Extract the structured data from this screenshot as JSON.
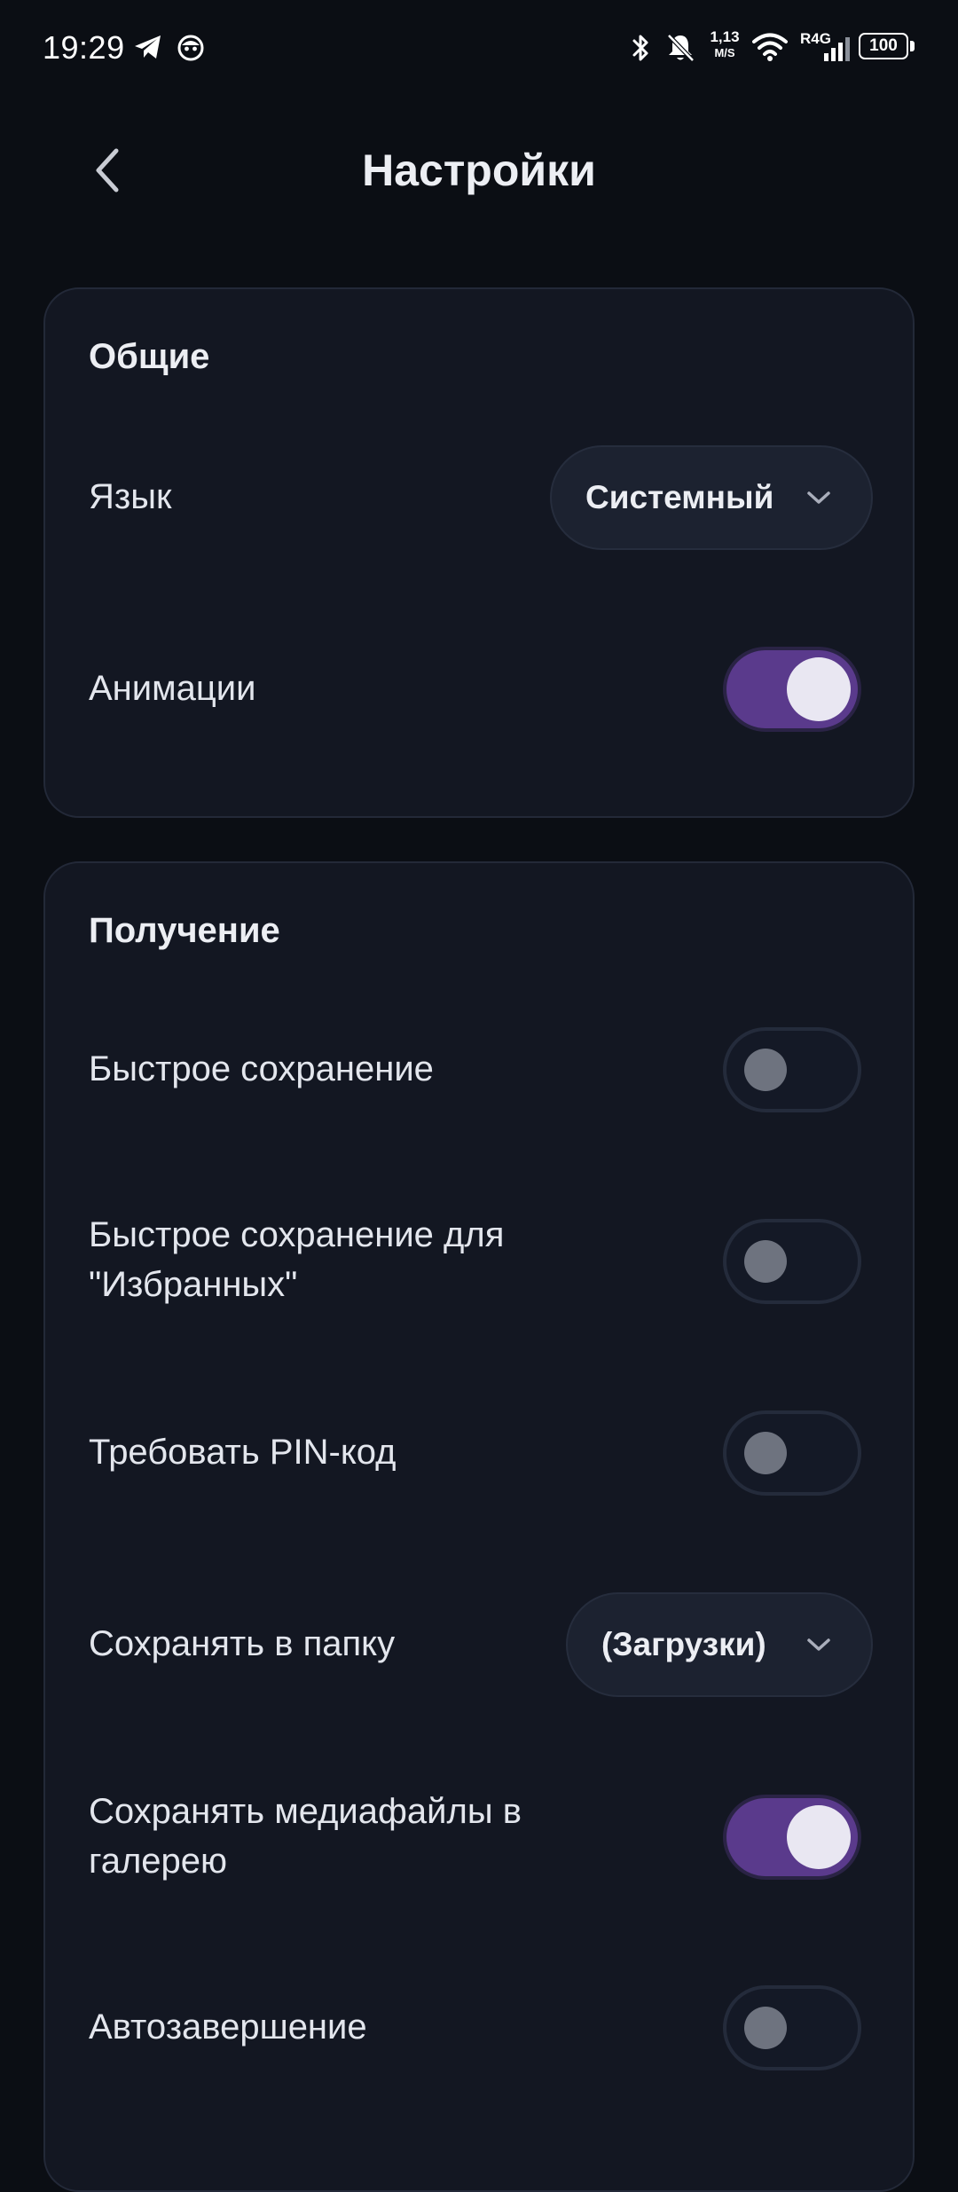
{
  "status_bar": {
    "time": "19:29",
    "icons": [
      "telegram-icon",
      "face-icon",
      "bluetooth-icon",
      "bell-off-icon",
      "wifi-icon",
      "signal-icon",
      "battery-icon"
    ],
    "net_speed_value": "1,13",
    "net_speed_unit": "M/S",
    "network_type": "R4G",
    "battery": "100"
  },
  "header": {
    "title": "Настройки",
    "back_icon": "chevron-left-icon"
  },
  "sections": {
    "general": {
      "title": "Общие",
      "language_label": "Язык",
      "language_value": "Системный",
      "animations_label": "Анимации",
      "animations_on": true
    },
    "receive": {
      "title": "Получение",
      "quick_save_label": "Быстрое сохранение",
      "quick_save_on": false,
      "quick_save_fav_label_line1": "Быстрое сохранение для",
      "quick_save_fav_label_line2": "\"Избранных\"",
      "quick_save_fav_on": false,
      "require_pin_label": "Требовать PIN-код",
      "require_pin_on": false,
      "save_folder_label": "Сохранять в папку",
      "save_folder_value": "(Загрузки)",
      "save_media_label_line1": "Сохранять медиафайлы в",
      "save_media_label_line2": "галерею",
      "save_media_on": true,
      "auto_finish_label": "Автозавершение",
      "auto_finish_on": false
    }
  },
  "colors": {
    "background": "#0b0e14",
    "card": "#131722",
    "toggle_on": "#5a3a8c",
    "toggle_off_knob": "#6e737f"
  }
}
